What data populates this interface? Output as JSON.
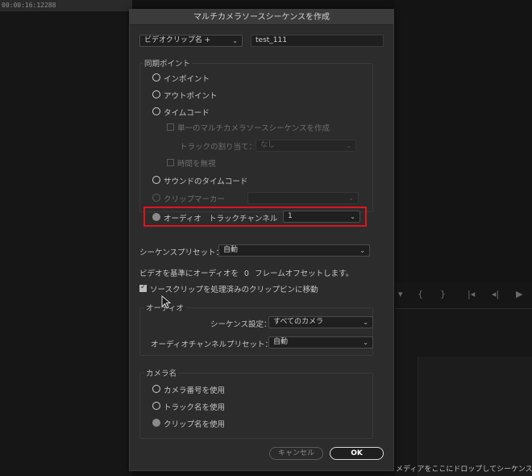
{
  "background": {
    "timecode": "00:00:16:12288",
    "drop_hint": "メディアをここにドロップしてシーケンス"
  },
  "dialog": {
    "title": "マルチカメラソースシーケンスを作成",
    "name_source": {
      "selected": "ビデオクリップ名 +"
    },
    "name_value": "test_111",
    "sync_point": {
      "legend": "同期ポイント",
      "in_point": "インポイント",
      "out_point": "アウトポイント",
      "timecode": "タイムコード",
      "create_single_sequence": "単一のマルチカメラソースシーケンスを作成",
      "track_assignment_label": "トラックの割り当て：",
      "track_assignment_value": "なし",
      "ignore_time": "時間を無視",
      "sound_timecode": "サウンドのタイムコード",
      "clip_marker": "クリップマーカー",
      "clip_marker_value": "",
      "audio": "オーディオ",
      "track_channel_label": "トラックチャンネル",
      "track_channel_value": "1"
    },
    "sequence_preset_label": "シーケンスプリセット：",
    "sequence_preset_value": "自動",
    "offset_prefix": "ビデオを基準にオーディオを",
    "offset_value": "0",
    "offset_suffix": "フレームオフセットします。",
    "move_source_clips": "ソースクリップを処理済みのクリップビンに移動",
    "audio_section": {
      "legend": "オーディオ",
      "sequence_settings_label": "シーケンス設定：",
      "sequence_settings_value": "すべてのカメラ",
      "channel_preset_label": "オーディオチャンネルプリセット：",
      "channel_preset_value": "自動"
    },
    "camera_name": {
      "legend": "カメラ名",
      "use_camera_number": "カメラ番号を使用",
      "use_track_name": "トラック名を使用",
      "use_clip_name": "クリップ名を使用"
    },
    "buttons": {
      "cancel": "キャンセル",
      "ok": "OK"
    }
  },
  "colors": {
    "highlight": "#e0141e",
    "dialog_bg": "#2c2c2c"
  },
  "icons": {
    "chevron": "chevron-down-icon",
    "transport": [
      "marker-icon",
      "in-bracket-icon",
      "out-bracket-icon",
      "go-to-in-icon",
      "step-back-icon"
    ]
  }
}
